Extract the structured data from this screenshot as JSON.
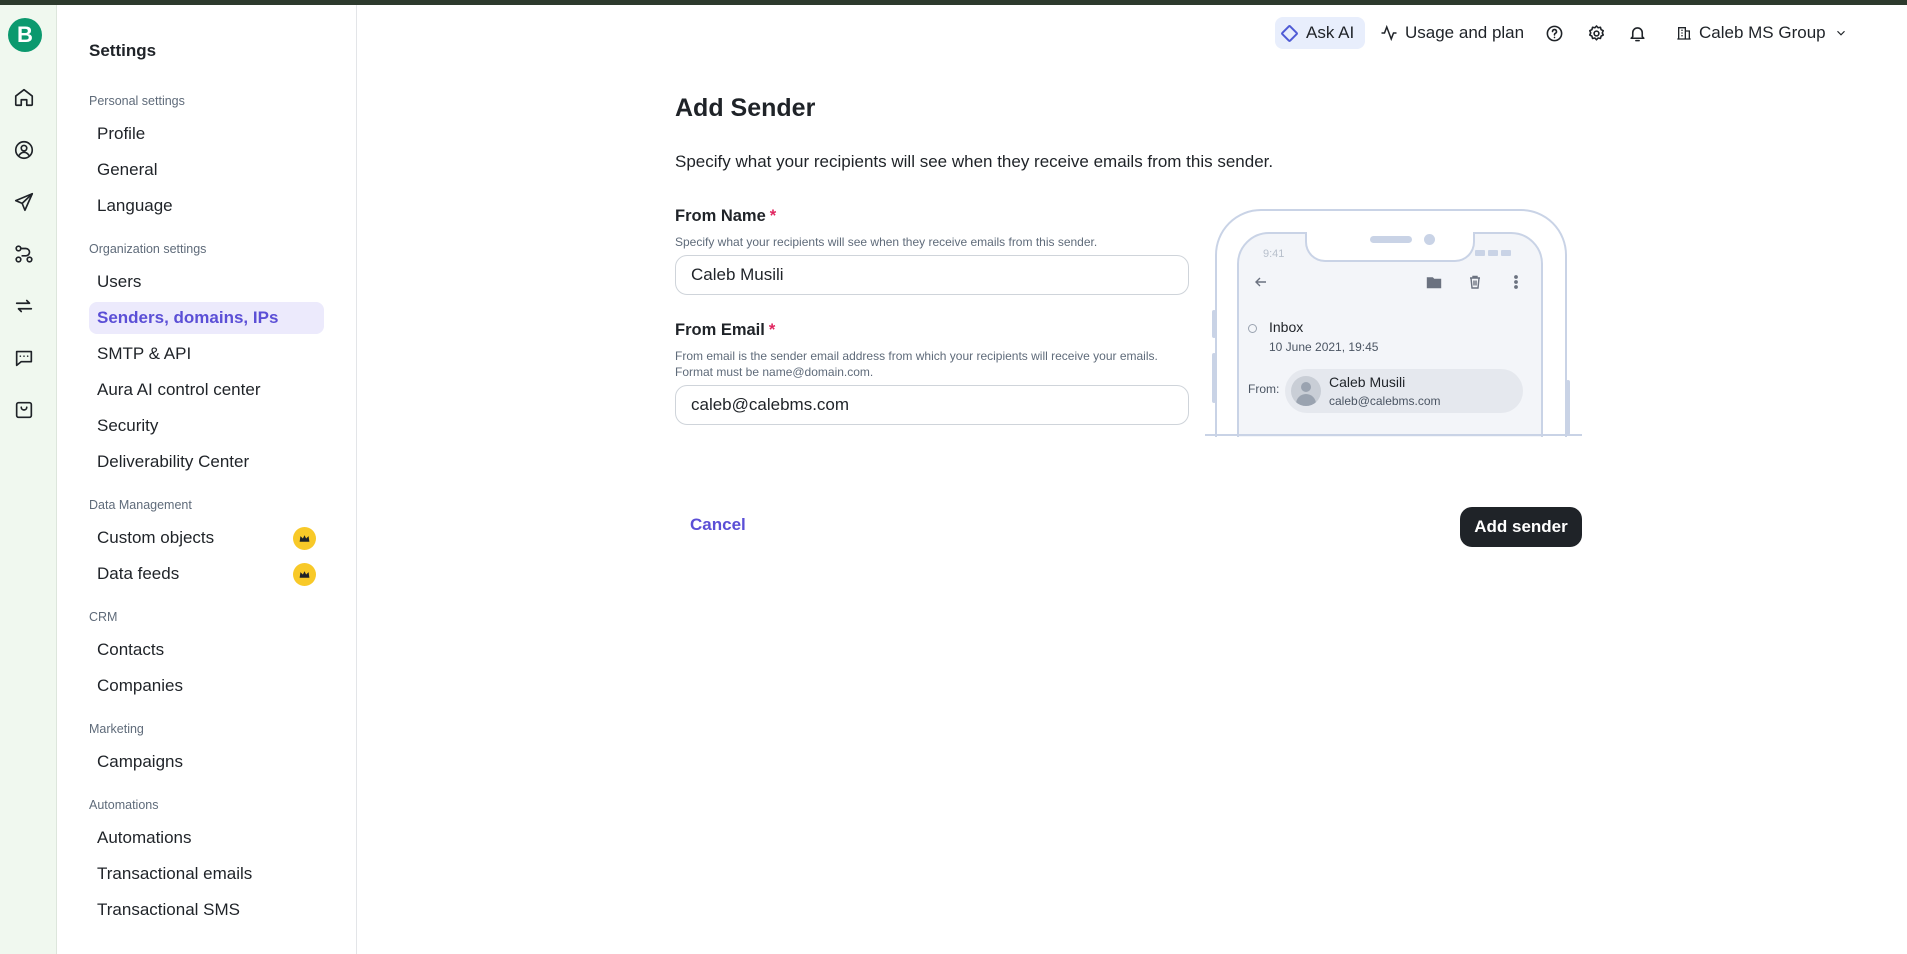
{
  "app": {
    "logo_letter": "B"
  },
  "topbar": {
    "ask_ai": "Ask AI",
    "usage": "Usage and plan",
    "org": "Caleb MS Group"
  },
  "rail": {
    "icons": [
      "home-icon",
      "contacts-icon",
      "campaigns-icon",
      "automations-icon",
      "sync-icon",
      "conversations-icon",
      "shop-icon"
    ]
  },
  "settings": {
    "title": "Settings",
    "sections": {
      "personal": "Personal settings",
      "organization": "Organization settings",
      "data": "Data Management",
      "crm": "CRM",
      "marketing": "Marketing",
      "automations": "Automations"
    },
    "items": {
      "profile": "Profile",
      "general": "General",
      "language": "Language",
      "users": "Users",
      "senders": "Senders, domains, IPs",
      "smtp": "SMTP & API",
      "aura": "Aura AI control center",
      "security": "Security",
      "deliverability": "Deliverability Center",
      "custom_objects": "Custom objects",
      "data_feeds": "Data feeds",
      "contacts": "Contacts",
      "companies": "Companies",
      "campaigns": "Campaigns",
      "automations": "Automations",
      "transactional_emails": "Transactional emails",
      "transactional_sms": "Transactional SMS"
    },
    "active": "senders"
  },
  "form": {
    "title": "Add Sender",
    "subtitle": "Specify what your recipients will see when they receive emails from this sender.",
    "from_name": {
      "label": "From Name",
      "required": "*",
      "help": "Specify what your recipients will see when they receive emails from this sender.",
      "value": "Caleb Musili"
    },
    "from_email": {
      "label": "From Email",
      "required": "*",
      "help_line1": "From email is the sender email address from which your recipients will receive your emails.",
      "help_line2": "Format must be name@domain.com.",
      "value": "caleb@calebms.com"
    },
    "cancel": "Cancel",
    "submit": "Add sender"
  },
  "preview": {
    "time": "9:41",
    "folder": "Inbox",
    "date": "10 June 2021, 19:45",
    "from_label": "From:",
    "sender_name": "Caleb Musili",
    "sender_email": "caleb@calebms.com"
  },
  "colors": {
    "accent": "#5b4fd6",
    "brand": "#0b996e",
    "rail_bg": "#f0f8ef",
    "premium": "#f8c928"
  }
}
